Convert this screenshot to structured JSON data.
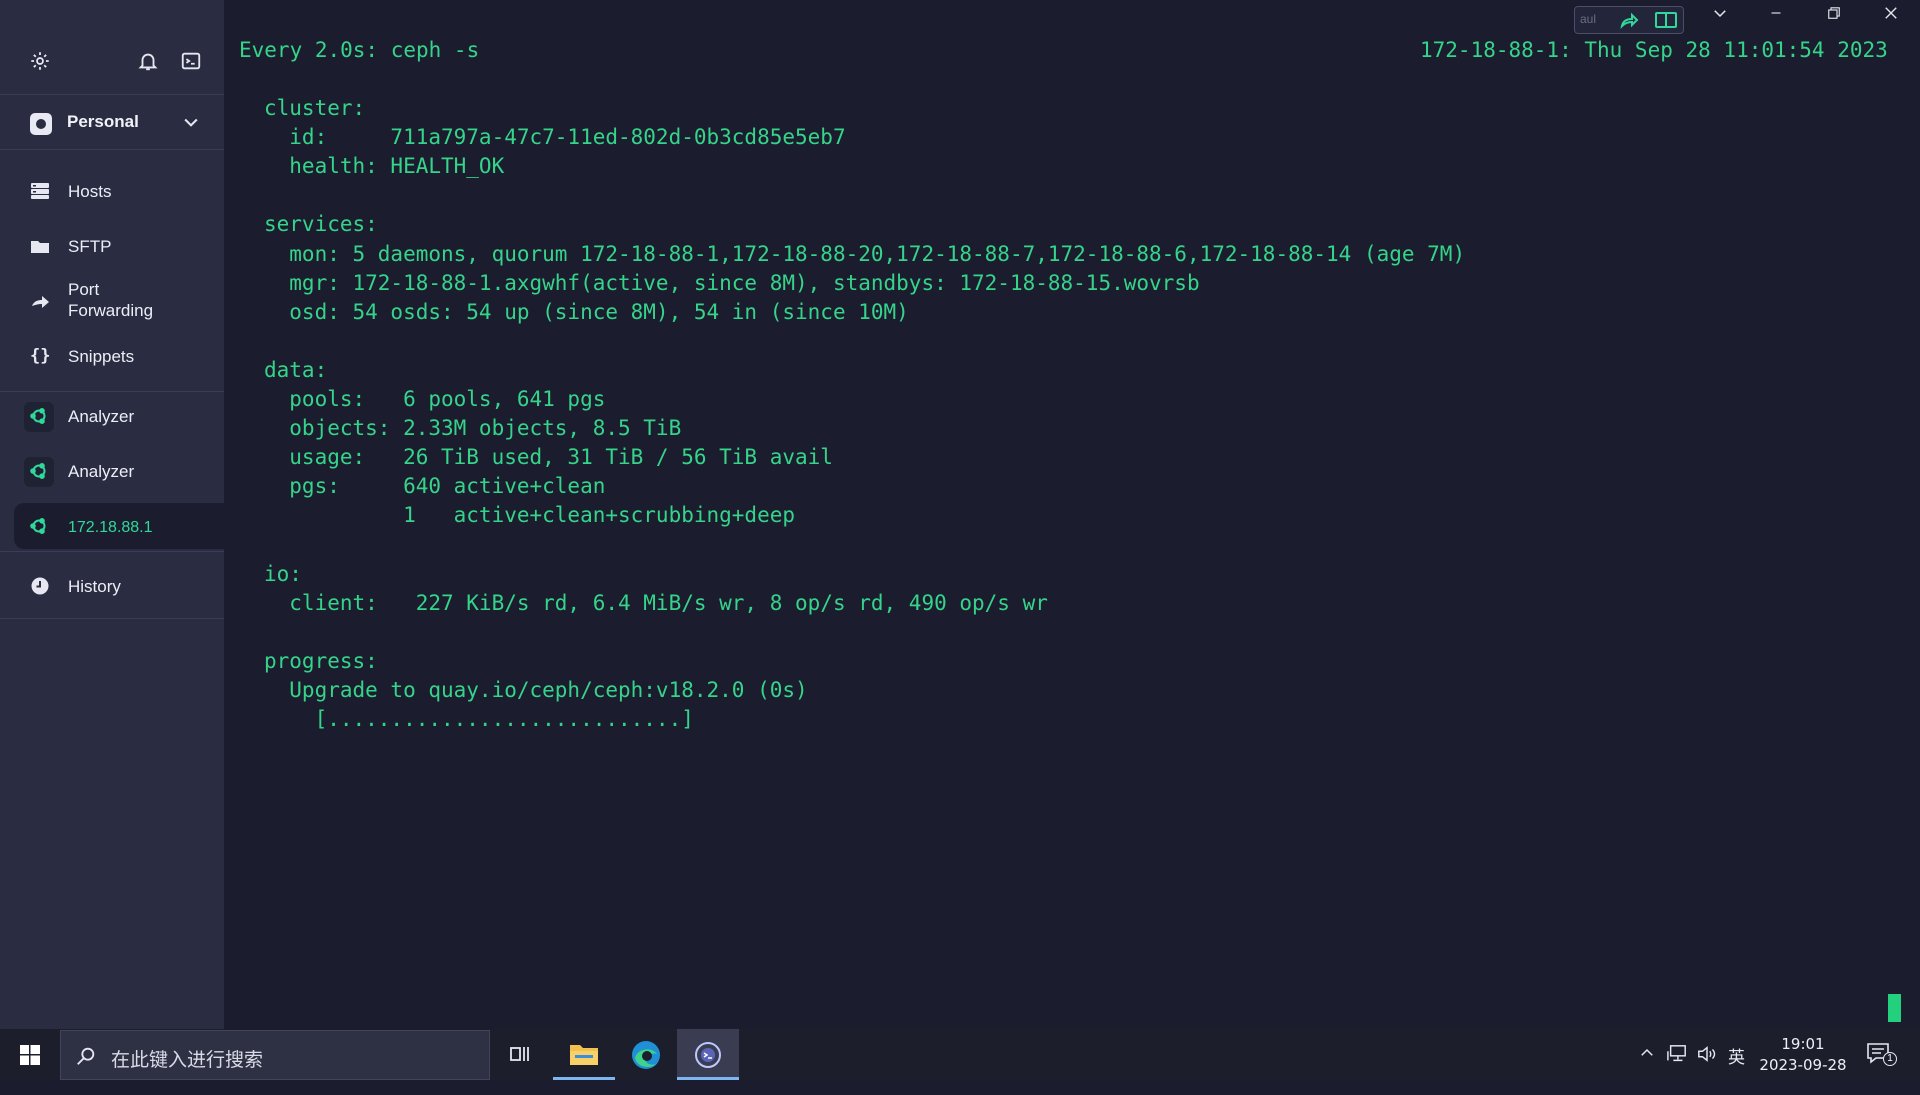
{
  "sidebar": {
    "vault": {
      "label": "Personal"
    },
    "items": [
      {
        "label": "Hosts",
        "icon": "hosts-icon"
      },
      {
        "label": "SFTP",
        "icon": "folder-icon"
      },
      {
        "label": "Port\nForwarding",
        "icon": "port-forwarding-icon"
      },
      {
        "label": "Snippets",
        "icon": "snippets-icon"
      },
      {
        "label": "Analyzer",
        "icon": "ubuntu-icon"
      },
      {
        "label": "Analyzer",
        "icon": "ubuntu-icon"
      },
      {
        "label": "172.18.88.1",
        "icon": "ubuntu-icon"
      },
      {
        "label": "History",
        "icon": "clock-icon"
      }
    ]
  },
  "terminal": {
    "header_left": "Every 2.0s: ceph -s",
    "header_right": "172-18-88-1: Thu Sep 28 11:01:54 2023",
    "lines": [
      "cluster:",
      "  id:     711a797a-47c7-11ed-802d-0b3cd85e5eb7",
      "  health: HEALTH_OK",
      "",
      "services:",
      "  mon: 5 daemons, quorum 172-18-88-1,172-18-88-20,172-18-88-7,172-18-88-6,172-18-88-14 (age 7M)",
      "  mgr: 172-18-88-1.axgwhf(active, since 8M), standbys: 172-18-88-15.wovrsb",
      "  osd: 54 osds: 54 up (since 8M), 54 in (since 10M)",
      "",
      "data:",
      "  pools:   6 pools, 641 pgs",
      "  objects: 2.33M objects, 8.5 TiB",
      "  usage:   26 TiB used, 31 TiB / 56 TiB avail",
      "  pgs:     640 active+clean",
      "           1   active+clean+scrubbing+deep",
      "",
      "io:",
      "  client:   227 KiB/s rd, 6.4 MiB/s wr, 8 op/s rd, 490 op/s wr",
      "",
      "progress:",
      "  Upgrade to quay.io/ceph/ceph:v18.2.0 (0s)",
      "    [............................]"
    ]
  },
  "window": {
    "toolbar_label": "aul"
  },
  "taskbar": {
    "search_placeholder": "在此键入进行搜索",
    "ime": "英",
    "time": "19:01",
    "date": "2023-09-28",
    "notification_count": "1"
  },
  "colors": {
    "terminal_fg": "#35d48a",
    "terminal_bg": "#1b1d2e",
    "sidebar_bg": "#2a2d42",
    "accent": "#30d89a"
  }
}
